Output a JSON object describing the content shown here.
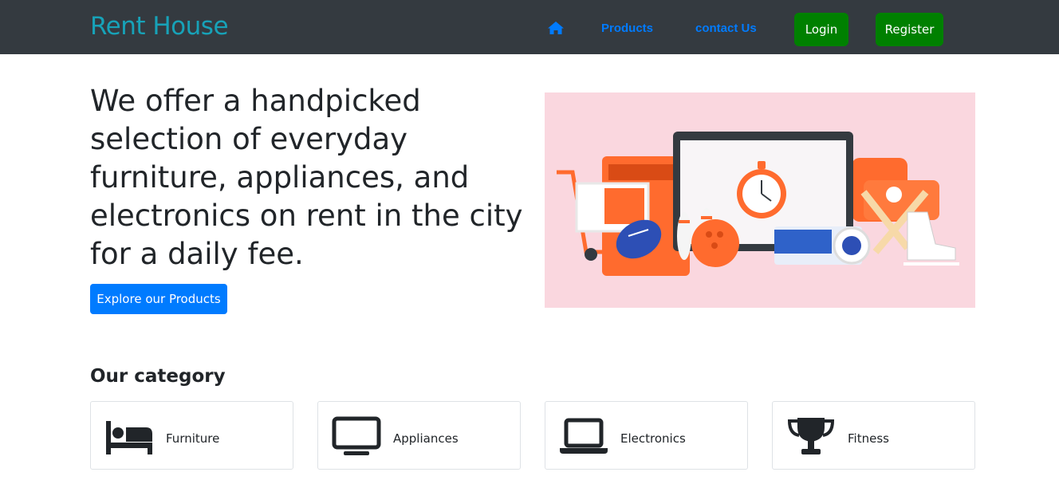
{
  "navbar": {
    "brand": "Rent House",
    "home_icon": "home-icon",
    "links": [
      {
        "label": "Products"
      },
      {
        "label": "contact Us"
      }
    ],
    "login_label": "Login",
    "register_label": "Register",
    "colors": {
      "bg": "#343a40",
      "brand": "#17a2b8",
      "link": "#007bff",
      "button": "#008000"
    }
  },
  "hero": {
    "heading": "We offer a handpicked selection of everyday furniture, appliances, and electronics on rent in the city for a daily fee.",
    "cta_label": "Explore our Products",
    "illustration_bg": "#fad7df"
  },
  "categories": {
    "title": "Our category",
    "items": [
      {
        "label": "Furniture",
        "icon": "bed-icon"
      },
      {
        "label": "Appliances",
        "icon": "monitor-icon"
      },
      {
        "label": "Electronics",
        "icon": "laptop-icon"
      },
      {
        "label": "Fitness",
        "icon": "trophy-icon"
      }
    ]
  }
}
